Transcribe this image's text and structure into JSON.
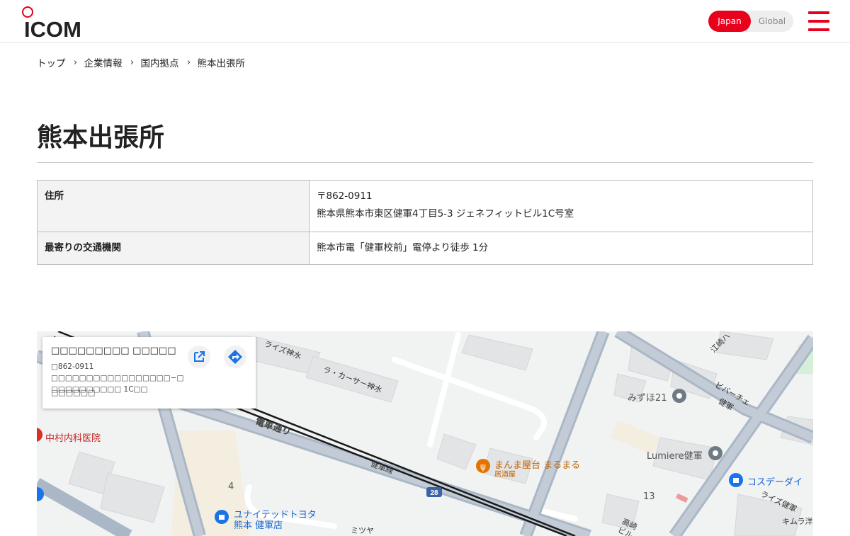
{
  "header": {
    "logo_text": "ICOM",
    "lang_japan": "Japan",
    "lang_global": "Global"
  },
  "breadcrumb": [
    "トップ",
    "企業情報",
    "国内拠点",
    "熊本出張所"
  ],
  "page_title": "熊本出張所",
  "info": {
    "address_label": "住所",
    "postal": "〒862-0911",
    "address": "熊本県熊本市東区健軍4丁目5-3 ジェネフィットビル1C号室",
    "transit_label": "最寄りの交通機関",
    "transit": "熊本市電「健軍校前」電停より徒歩 1分"
  },
  "map": {
    "card_name": "□□□□□□□□□ □□□□□",
    "card_address": "□862-0911 □□□□□□□□□□□□□□□□□−□ □□□□□□□□□□ 1C□□",
    "card_link": "□□□□□□",
    "labels": {
      "nakamura": "中村内科医院",
      "rise_shinsui": "ライズ神水",
      "ra_car": "ラ・カーサー神水",
      "densha_dori": "電車通り",
      "kengun_sen": "健軍線",
      "route_28": "28",
      "manma": "まんま屋台 まるまる",
      "izakaya": "居酒屋",
      "mizuho": "みずほ21",
      "lumiere": "Lumiere健軍",
      "cosde": "コスデーダイ",
      "united_1": "ユナイテッドトヨタ",
      "united_2": "熊本 健軍店",
      "num4": "4",
      "num13": "13",
      "mitsuya": "ミツヤ",
      "rise_kengun": "ライズ健軍",
      "kimura": "キムラ洋",
      "koho": "江崎ハ",
      "bibache": "ビバーチェ",
      "bibache2": "健軍",
      "takasaki": "高崎",
      "takasaki2": "ビル"
    }
  },
  "colors": {
    "brand_red": "#e8001c",
    "road": "#a9b7c6",
    "tram": "#1a1a1a",
    "poi_orange": "#e37400",
    "poi_blue": "#1a73e8",
    "poi_red": "#d93025"
  },
  "icons": [
    "logo-icon",
    "menu-icon",
    "chevron-right-icon",
    "open-external-icon",
    "directions-icon",
    "map-pin-icon"
  ]
}
